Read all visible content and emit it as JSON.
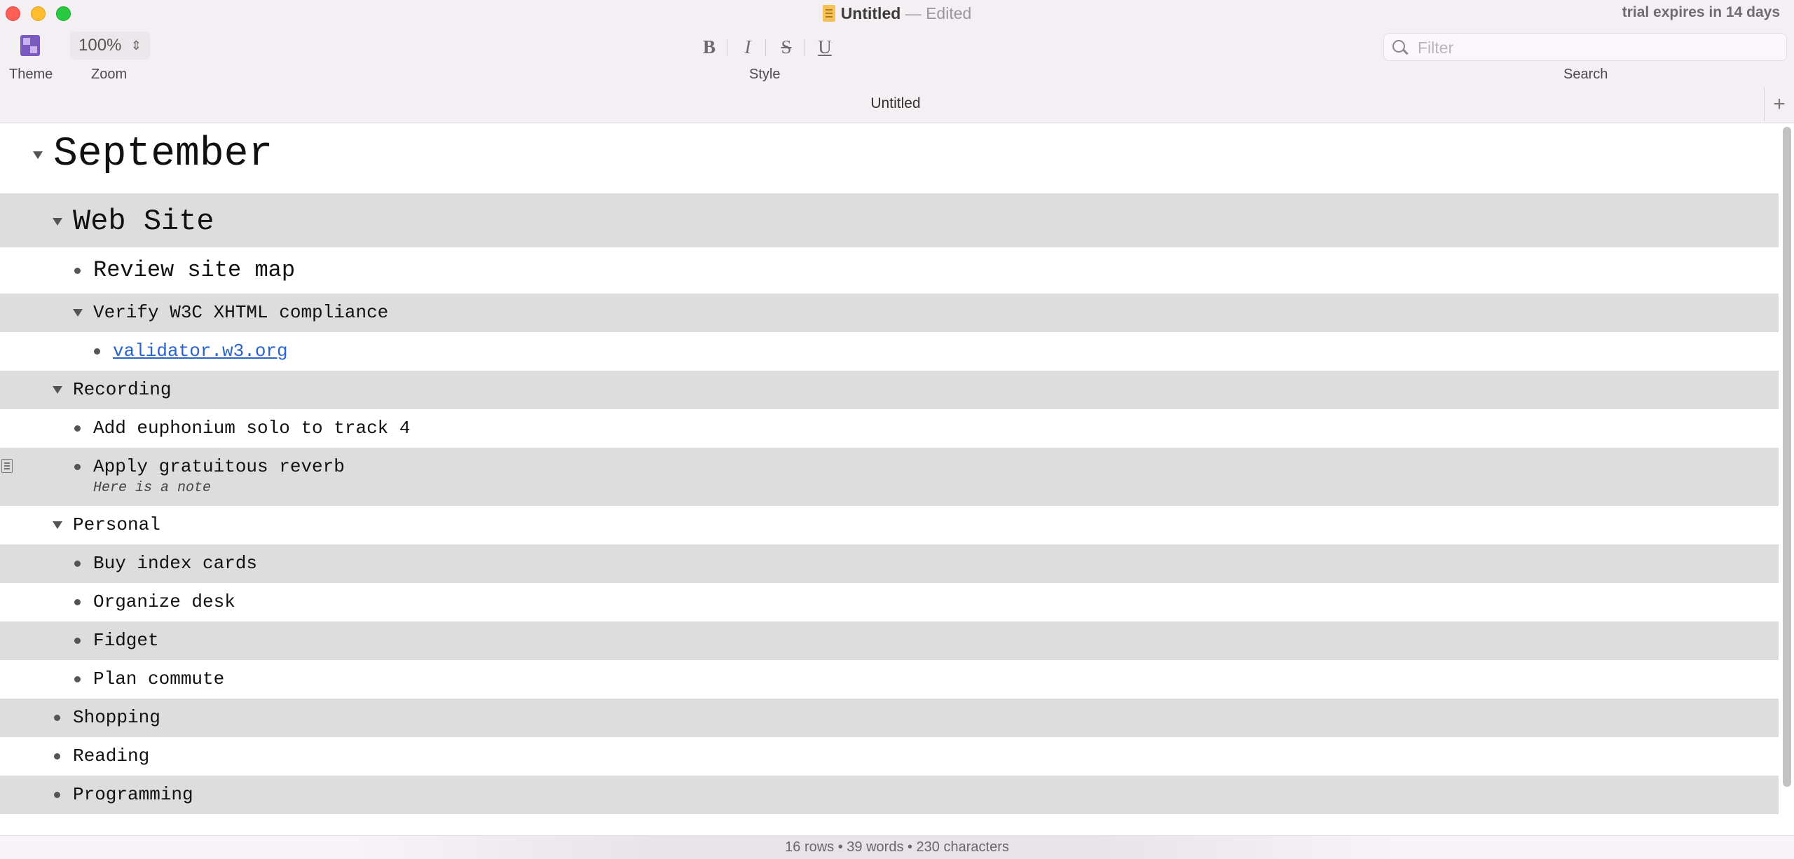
{
  "window": {
    "title": "Untitled",
    "edited": "— Edited",
    "trial": "trial expires in 14 days"
  },
  "toolbar": {
    "theme_label": "Theme",
    "zoom_label": "Zoom",
    "zoom_value": "100%",
    "style_label": "Style",
    "bold": "B",
    "italic": "I",
    "strike": "S",
    "underline": "U",
    "search_label": "Search",
    "search_placeholder": "Filter"
  },
  "tab": {
    "title": "Untitled",
    "add": "+"
  },
  "outline": {
    "rows": [
      {
        "text": "September",
        "level": 0,
        "kind": "toggle",
        "size": "h1"
      },
      {
        "text": "Web Site",
        "level": 1,
        "kind": "toggle",
        "size": "h2"
      },
      {
        "text": "Review site map",
        "level": 2,
        "kind": "bullet",
        "size": "h3"
      },
      {
        "text": "Verify W3C XHTML compliance",
        "level": 2,
        "kind": "toggle",
        "size": "normal"
      },
      {
        "text": "validator.w3.org",
        "level": 3,
        "kind": "bullet",
        "size": "normal",
        "link": true
      },
      {
        "text": "Recording",
        "level": 1,
        "kind": "toggle",
        "size": "normal"
      },
      {
        "text": "Add euphonium solo to track 4",
        "level": 2,
        "kind": "bullet",
        "size": "normal"
      },
      {
        "text": "Apply gratuitous reverb",
        "level": 2,
        "kind": "bullet",
        "size": "normal",
        "note": "Here is a note"
      },
      {
        "text": "Personal",
        "level": 1,
        "kind": "toggle",
        "size": "normal"
      },
      {
        "text": "Buy index cards",
        "level": 2,
        "kind": "bullet",
        "size": "normal"
      },
      {
        "text": "Organize desk",
        "level": 2,
        "kind": "bullet",
        "size": "normal"
      },
      {
        "text": "Fidget",
        "level": 2,
        "kind": "bullet",
        "size": "normal"
      },
      {
        "text": "Plan commute",
        "level": 2,
        "kind": "bullet",
        "size": "normal"
      },
      {
        "text": "Shopping",
        "level": 1,
        "kind": "bullet",
        "size": "normal"
      },
      {
        "text": "Reading",
        "level": 1,
        "kind": "bullet",
        "size": "normal"
      },
      {
        "text": "Programming",
        "level": 1,
        "kind": "bullet",
        "size": "normal"
      }
    ]
  },
  "status": {
    "text": "16 rows • 39 words • 230 characters"
  }
}
